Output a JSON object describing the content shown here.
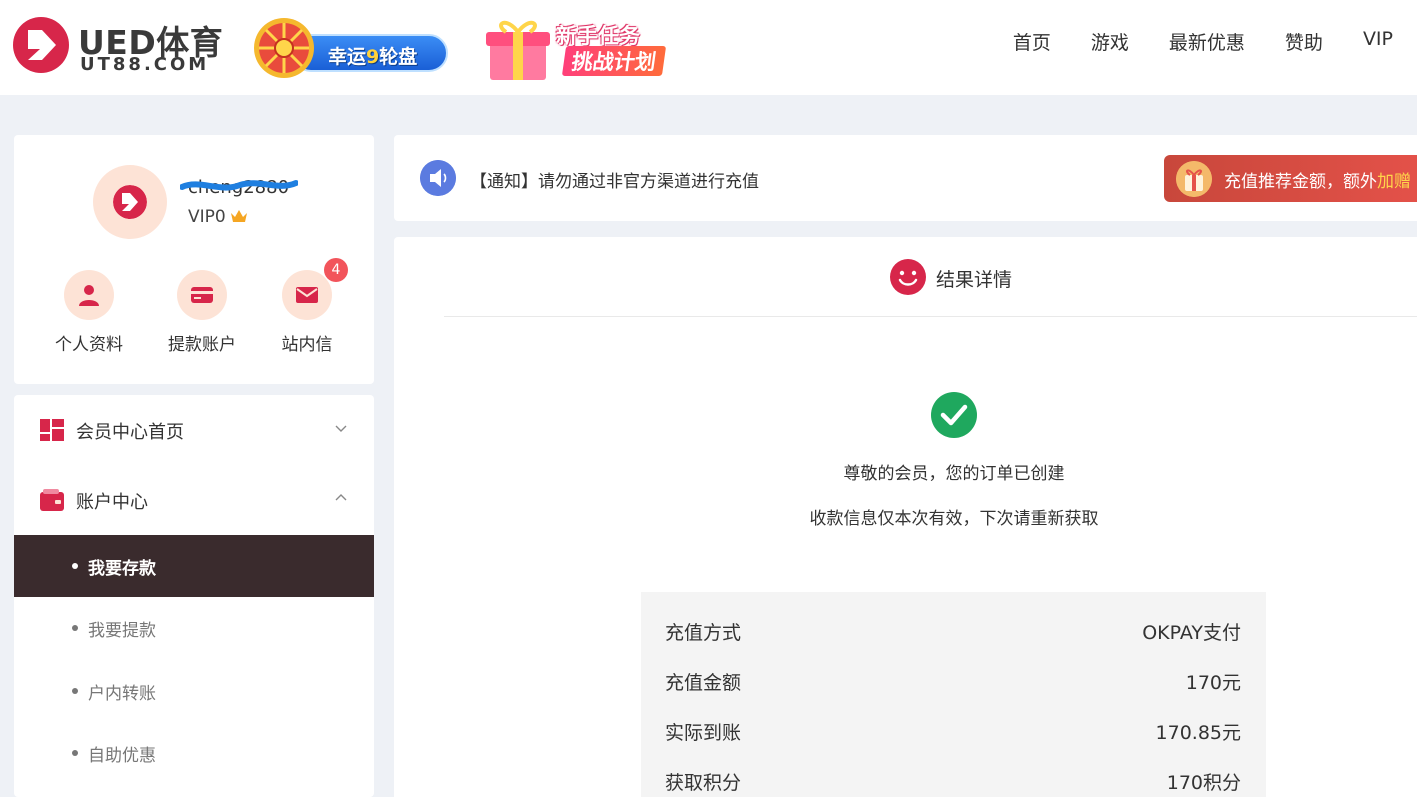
{
  "brand": {
    "title": "UED体育",
    "domain": "UT88.COM",
    "colors": {
      "primary": "#d7264a",
      "accent": "#ffd54a",
      "menu_active": "#3a2b2d",
      "success": "#1fa85e"
    }
  },
  "banners": {
    "wheel": {
      "text_prefix": "幸运",
      "text_number": "9",
      "text_suffix": "轮盘"
    },
    "task": {
      "line1": "新手任务",
      "line2": "挑战计划"
    }
  },
  "nav": {
    "items": [
      "首页",
      "游戏",
      "最新优惠",
      "赞助",
      "VIP"
    ]
  },
  "profile": {
    "username": "cheng2880",
    "vip_level": "VIP0",
    "quick_links": [
      {
        "label": "个人资料",
        "icon": "user-icon"
      },
      {
        "label": "提款账户",
        "icon": "card-icon"
      },
      {
        "label": "站内信",
        "icon": "mail-icon",
        "badge": "4"
      }
    ]
  },
  "menu": {
    "groups": [
      {
        "label": "会员中心首页",
        "icon": "dashboard-icon",
        "expanded": false
      },
      {
        "label": "账户中心",
        "icon": "wallet-icon",
        "expanded": true
      }
    ],
    "sub_items": [
      {
        "label": "我要存款",
        "active": true
      },
      {
        "label": "我要提款",
        "active": false
      },
      {
        "label": "户内转账",
        "active": false
      },
      {
        "label": "自助优惠",
        "active": false
      }
    ]
  },
  "notice": {
    "text": "【通知】请勿通过非官方渠道进行充值",
    "promo_text": "充值推荐金额，额外",
    "promo_highlight": "加赠"
  },
  "result": {
    "title": "结果详情",
    "message_line1": "尊敬的会员，您的订单已创建",
    "message_line2": "收款信息仅本次有效，下次请重新获取",
    "details": [
      {
        "label": "充值方式",
        "value": "OKPAY支付"
      },
      {
        "label": "充值金额",
        "value": "170元"
      },
      {
        "label": "实际到账",
        "value": "170.85元"
      },
      {
        "label": "获取积分",
        "value": "170积分"
      }
    ]
  }
}
